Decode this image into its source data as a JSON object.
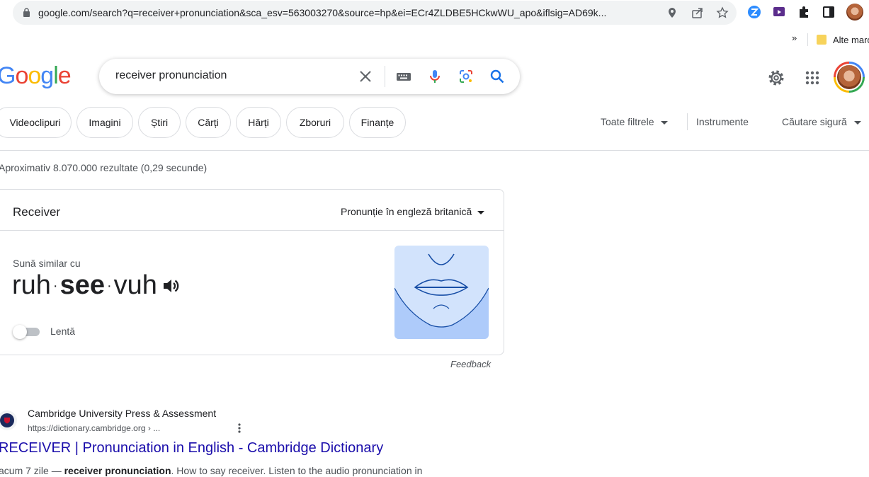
{
  "browser": {
    "url": "google.com/search?q=receiver+pronunciation&sca_esv=563003270&source=hp&ei=ECr4ZLDBE5HCkwWU_apo&iflsig=AD69k...",
    "bookmarks_overflow": "»",
    "bookmarks_folder": "Alte marcaje"
  },
  "logo": [
    "G",
    "o",
    "o",
    "g",
    "l",
    "e"
  ],
  "logo_colors": [
    "#4285f4",
    "#ea4335",
    "#fbbc05",
    "#4285f4",
    "#34a853",
    "#ea4335"
  ],
  "search": {
    "query": "receiver pronunciation"
  },
  "chips": [
    "Videoclipuri",
    "Imagini",
    "Știri",
    "Cărți",
    "Hărți",
    "Zboruri",
    "Finanțe"
  ],
  "tools": {
    "all_filters": "Toate filtrele",
    "instruments": "Instrumente",
    "safe_search": "Căutare sigură"
  },
  "stats": "Aproximativ 8.070.000 rezultate (0,29 secunde)",
  "card": {
    "title": "Receiver",
    "dialect": "Pronunție în engleză britanică",
    "sounds_like": "Sună similar cu",
    "syllables": [
      "ruh",
      "see",
      "vuh"
    ],
    "separator": "·",
    "slow": "Lentă",
    "feedback": "Feedback"
  },
  "result": {
    "site": "Cambridge University Press & Assessment",
    "url": "https://dictionary.cambridge.org › ...",
    "title": "RECEIVER | Pronunciation in English - Cambridge Dictionary",
    "snippet_date": "acum 7 zile — ",
    "snippet_bold": "receiver pronunciation",
    "snippet_rest": ". How to say receiver. Listen to the audio pronunciation in"
  },
  "colors": {
    "link": "#1a0dab",
    "accent_blue": "#4285f4",
    "mouth_bg": "#d2e3fc",
    "mouth_line": "#174ea6"
  }
}
